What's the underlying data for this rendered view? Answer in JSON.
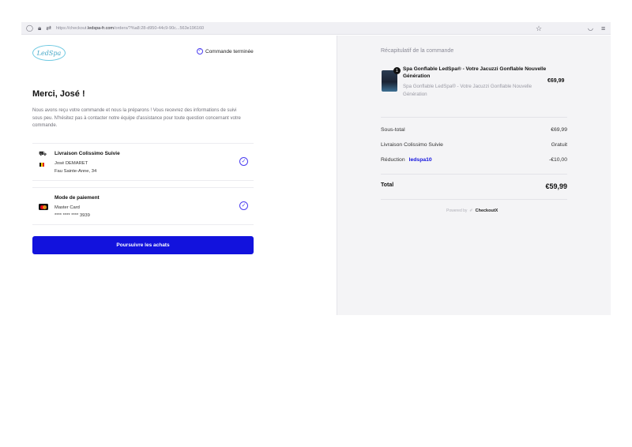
{
  "browser": {
    "url_prefix": "https://checkout.",
    "url_host": "ledspa-fr.com",
    "url_path": "/orders/?%a8:28-d950-44c9-90c...563e196160"
  },
  "header": {
    "logo_text": "LedSpa",
    "status_label": "Commande terminée"
  },
  "main": {
    "greeting": "Merci, José !",
    "intro": "Nous avons reçu votre commande et nous la préparons ! Vous recevrez des informations de suivi sous peu. N'hésitez pas à contacter notre équipe d'assistance pour toute question concernant votre commande."
  },
  "shipping": {
    "title": "Livraison Colissimo Suivie",
    "name": "José DEMARET",
    "address": "Fau Sainte-Anne, 34"
  },
  "payment": {
    "title": "Mode de paiement",
    "method": "Master Card",
    "card_number": "**** **** **** 3939"
  },
  "continue_label": "Poursuivre les achats",
  "summary": {
    "title": "Récapitulatif de la commande",
    "item": {
      "quantity": "1",
      "name": "Spa Gonflable LedSpa® - Votre Jacuzzi Gonflable Nouvelle Génération",
      "variant": "Spa Gonflable LedSpa® - Votre Jacuzzi Gonflable Nouvelle Génération",
      "price": "€69,99"
    },
    "subtotal_label": "Sous-total",
    "subtotal_value": "€69,99",
    "shipping_label": "Livraison Colissimo Suivie",
    "shipping_value": "Gratuit",
    "discount_label": "Réduction",
    "discount_code": "ledspa10",
    "discount_value": "-€10,00",
    "total_label": "Total",
    "total_value": "€59,99",
    "powered_by": "Powered by",
    "powered_brand": "CheckoutX"
  },
  "colors": {
    "accent": "#1212dd",
    "check": "#4b3df0"
  }
}
